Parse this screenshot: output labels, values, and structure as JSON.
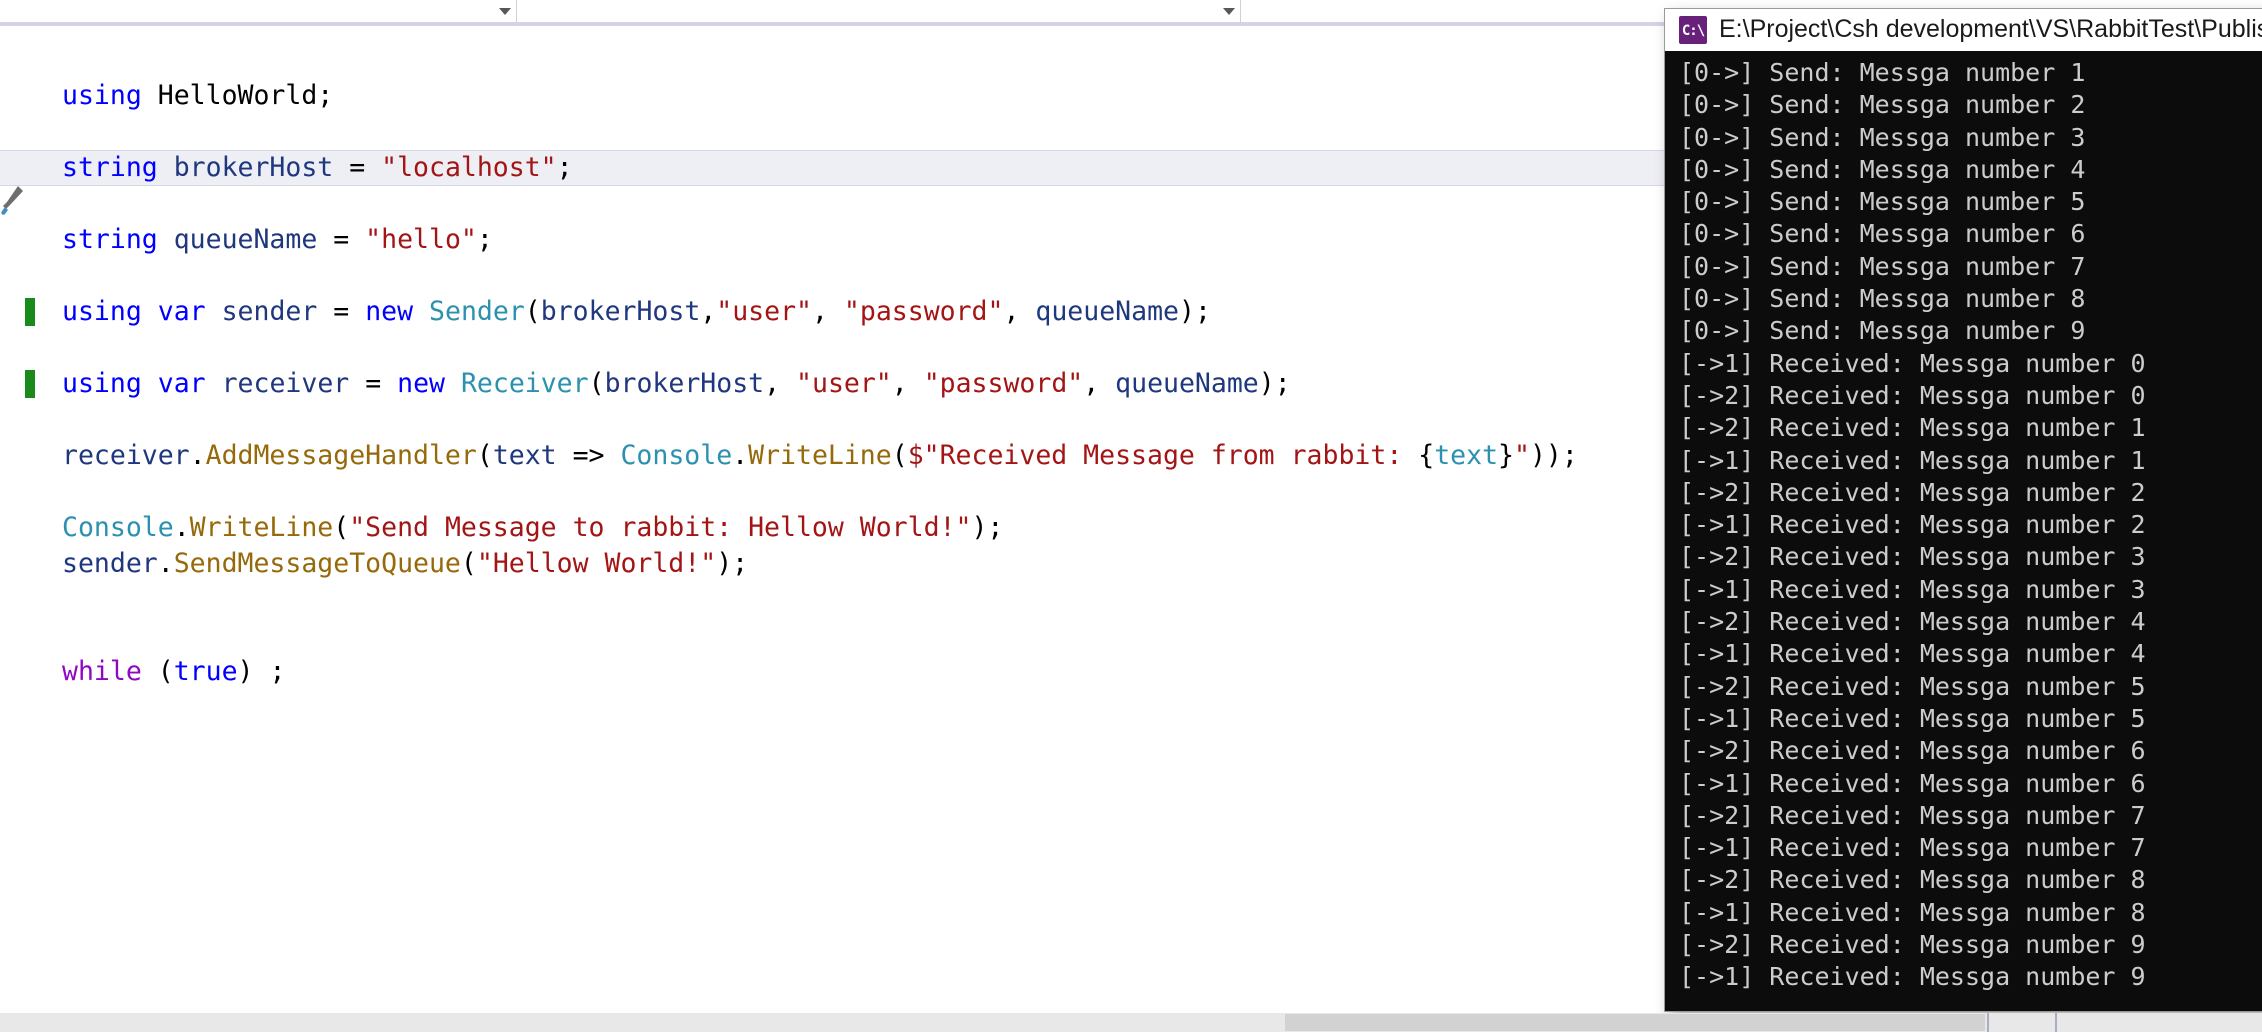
{
  "window": {
    "app": "Visual Studio Code Editor",
    "language": "csharp"
  },
  "navbar": {
    "combo_left_value": "",
    "combo_mid_value": "",
    "combo_right_value": "",
    "arrow_icon": "chevron-down-icon"
  },
  "editor": {
    "file_language": "C#",
    "current_line_index": 2,
    "lines": [
      {
        "id": "line-using-helloworld",
        "current": false,
        "changebar": false,
        "tokens": [
          {
            "cls": "t-kw",
            "text": "using"
          },
          {
            "cls": "t-plain",
            "text": " "
          },
          {
            "cls": "t-plain",
            "text": "HelloWorld"
          },
          {
            "cls": "t-plain",
            "text": ";"
          }
        ]
      },
      {
        "id": "line-blank-1",
        "current": false,
        "changebar": false,
        "tokens": []
      },
      {
        "id": "line-brokerhost",
        "current": true,
        "changebar": false,
        "tokens": [
          {
            "cls": "t-kw",
            "text": "string"
          },
          {
            "cls": "t-plain",
            "text": " "
          },
          {
            "cls": "t-local",
            "text": "brokerHost"
          },
          {
            "cls": "t-plain",
            "text": " = "
          },
          {
            "cls": "t-str",
            "text": "\"localhost\""
          },
          {
            "cls": "t-plain",
            "text": ";"
          }
        ]
      },
      {
        "id": "line-blank-2",
        "current": false,
        "changebar": false,
        "tokens": []
      },
      {
        "id": "line-queuename",
        "current": false,
        "changebar": false,
        "tokens": [
          {
            "cls": "t-kw",
            "text": "string"
          },
          {
            "cls": "t-plain",
            "text": " "
          },
          {
            "cls": "t-local",
            "text": "queueName"
          },
          {
            "cls": "t-plain",
            "text": " = "
          },
          {
            "cls": "t-str",
            "text": "\"hello\""
          },
          {
            "cls": "t-plain",
            "text": ";"
          }
        ]
      },
      {
        "id": "line-blank-3",
        "current": false,
        "changebar": false,
        "tokens": []
      },
      {
        "id": "line-sender",
        "current": false,
        "changebar": true,
        "tokens": [
          {
            "cls": "t-kw",
            "text": "using"
          },
          {
            "cls": "t-plain",
            "text": " "
          },
          {
            "cls": "t-kw",
            "text": "var"
          },
          {
            "cls": "t-plain",
            "text": " "
          },
          {
            "cls": "t-local",
            "text": "sender"
          },
          {
            "cls": "t-plain",
            "text": " = "
          },
          {
            "cls": "t-kw",
            "text": "new"
          },
          {
            "cls": "t-plain",
            "text": " "
          },
          {
            "cls": "t-type",
            "text": "Sender"
          },
          {
            "cls": "t-plain",
            "text": "("
          },
          {
            "cls": "t-local",
            "text": "brokerHost"
          },
          {
            "cls": "t-plain",
            "text": ","
          },
          {
            "cls": "t-str",
            "text": "\"user\""
          },
          {
            "cls": "t-plain",
            "text": ", "
          },
          {
            "cls": "t-str",
            "text": "\"password\""
          },
          {
            "cls": "t-plain",
            "text": ", "
          },
          {
            "cls": "t-local",
            "text": "queueName"
          },
          {
            "cls": "t-plain",
            "text": ");"
          }
        ]
      },
      {
        "id": "line-blank-4",
        "current": false,
        "changebar": false,
        "tokens": []
      },
      {
        "id": "line-receiver",
        "current": false,
        "changebar": true,
        "tokens": [
          {
            "cls": "t-kw",
            "text": "using"
          },
          {
            "cls": "t-plain",
            "text": " "
          },
          {
            "cls": "t-kw",
            "text": "var"
          },
          {
            "cls": "t-plain",
            "text": " "
          },
          {
            "cls": "t-local",
            "text": "receiver"
          },
          {
            "cls": "t-plain",
            "text": " = "
          },
          {
            "cls": "t-kw",
            "text": "new"
          },
          {
            "cls": "t-plain",
            "text": " "
          },
          {
            "cls": "t-type",
            "text": "Receiver"
          },
          {
            "cls": "t-plain",
            "text": "("
          },
          {
            "cls": "t-local",
            "text": "brokerHost"
          },
          {
            "cls": "t-plain",
            "text": ", "
          },
          {
            "cls": "t-str",
            "text": "\"user\""
          },
          {
            "cls": "t-plain",
            "text": ", "
          },
          {
            "cls": "t-str",
            "text": "\"password\""
          },
          {
            "cls": "t-plain",
            "text": ", "
          },
          {
            "cls": "t-local",
            "text": "queueName"
          },
          {
            "cls": "t-plain",
            "text": ");"
          }
        ]
      },
      {
        "id": "line-blank-5",
        "current": false,
        "changebar": false,
        "tokens": []
      },
      {
        "id": "line-addmessagehandler",
        "current": false,
        "changebar": false,
        "tokens": [
          {
            "cls": "t-local",
            "text": "receiver"
          },
          {
            "cls": "t-plain",
            "text": "."
          },
          {
            "cls": "t-method",
            "text": "AddMessageHandler"
          },
          {
            "cls": "t-plain",
            "text": "("
          },
          {
            "cls": "t-local",
            "text": "text"
          },
          {
            "cls": "t-plain",
            "text": " => "
          },
          {
            "cls": "t-type",
            "text": "Console"
          },
          {
            "cls": "t-plain",
            "text": "."
          },
          {
            "cls": "t-method",
            "text": "WriteLine"
          },
          {
            "cls": "t-plain",
            "text": "("
          },
          {
            "cls": "t-str",
            "text": "$\"Received Message from rabbit: "
          },
          {
            "cls": "t-plain",
            "text": "{"
          },
          {
            "cls": "t-interp",
            "text": "text"
          },
          {
            "cls": "t-plain",
            "text": "}"
          },
          {
            "cls": "t-str",
            "text": "\""
          },
          {
            "cls": "t-plain",
            "text": "));"
          }
        ]
      },
      {
        "id": "line-blank-6",
        "current": false,
        "changebar": false,
        "tokens": []
      },
      {
        "id": "line-console-writeline-send",
        "current": false,
        "changebar": false,
        "tokens": [
          {
            "cls": "t-type",
            "text": "Console"
          },
          {
            "cls": "t-plain",
            "text": "."
          },
          {
            "cls": "t-method",
            "text": "WriteLine"
          },
          {
            "cls": "t-plain",
            "text": "("
          },
          {
            "cls": "t-str",
            "text": "\"Send Message to rabbit: Hellow World!\""
          },
          {
            "cls": "t-plain",
            "text": ");"
          }
        ]
      },
      {
        "id": "line-sendmessagetoqueue",
        "current": false,
        "changebar": false,
        "tokens": [
          {
            "cls": "t-local",
            "text": "sender"
          },
          {
            "cls": "t-plain",
            "text": "."
          },
          {
            "cls": "t-method",
            "text": "SendMessageToQueue"
          },
          {
            "cls": "t-plain",
            "text": "("
          },
          {
            "cls": "t-str",
            "text": "\"Hellow World!\""
          },
          {
            "cls": "t-plain",
            "text": ");"
          }
        ]
      },
      {
        "id": "line-blank-7",
        "current": false,
        "changebar": false,
        "tokens": []
      },
      {
        "id": "line-blank-8",
        "current": false,
        "changebar": false,
        "tokens": []
      },
      {
        "id": "line-while-true",
        "current": false,
        "changebar": false,
        "tokens": [
          {
            "cls": "t-ctrl",
            "text": "while"
          },
          {
            "cls": "t-plain",
            "text": " ("
          },
          {
            "cls": "t-kw",
            "text": "true"
          },
          {
            "cls": "t-plain",
            "text": ") ;"
          }
        ]
      }
    ]
  },
  "console": {
    "icon": "csharp-console-app-icon",
    "icon_glyph": "C:\\",
    "title": "E:\\Project\\Csh development\\VS\\RabbitTest\\PublishS",
    "fg_color": "#cccccc",
    "bg_color": "#0c0c0c",
    "lines": [
      "[0->] Send: Messga number 1",
      "[0->] Send: Messga number 2",
      "[0->] Send: Messga number 3",
      "[0->] Send: Messga number 4",
      "[0->] Send: Messga number 5",
      "[0->] Send: Messga number 6",
      "[0->] Send: Messga number 7",
      "[0->] Send: Messga number 8",
      "[0->] Send: Messga number 9",
      "[->1] Received: Messga number 0",
      "[->2] Received: Messga number 0",
      "[->2] Received: Messga number 1",
      "[->1] Received: Messga number 1",
      "[->2] Received: Messga number 2",
      "[->1] Received: Messga number 2",
      "[->2] Received: Messga number 3",
      "[->1] Received: Messga number 3",
      "[->2] Received: Messga number 4",
      "[->1] Received: Messga number 4",
      "[->2] Received: Messga number 5",
      "[->1] Received: Messga number 5",
      "[->2] Received: Messga number 6",
      "[->1] Received: Messga number 6",
      "[->2] Received: Messga number 7",
      "[->1] Received: Messga number 7",
      "[->2] Received: Messga number 8",
      "[->1] Received: Messga number 8",
      "[->2] Received: Messga number 9",
      "[->1] Received: Messga number 9"
    ]
  },
  "scrollbar": {
    "orientation": "horizontal",
    "thumb_label": "horizontal-scroll-thumb"
  }
}
